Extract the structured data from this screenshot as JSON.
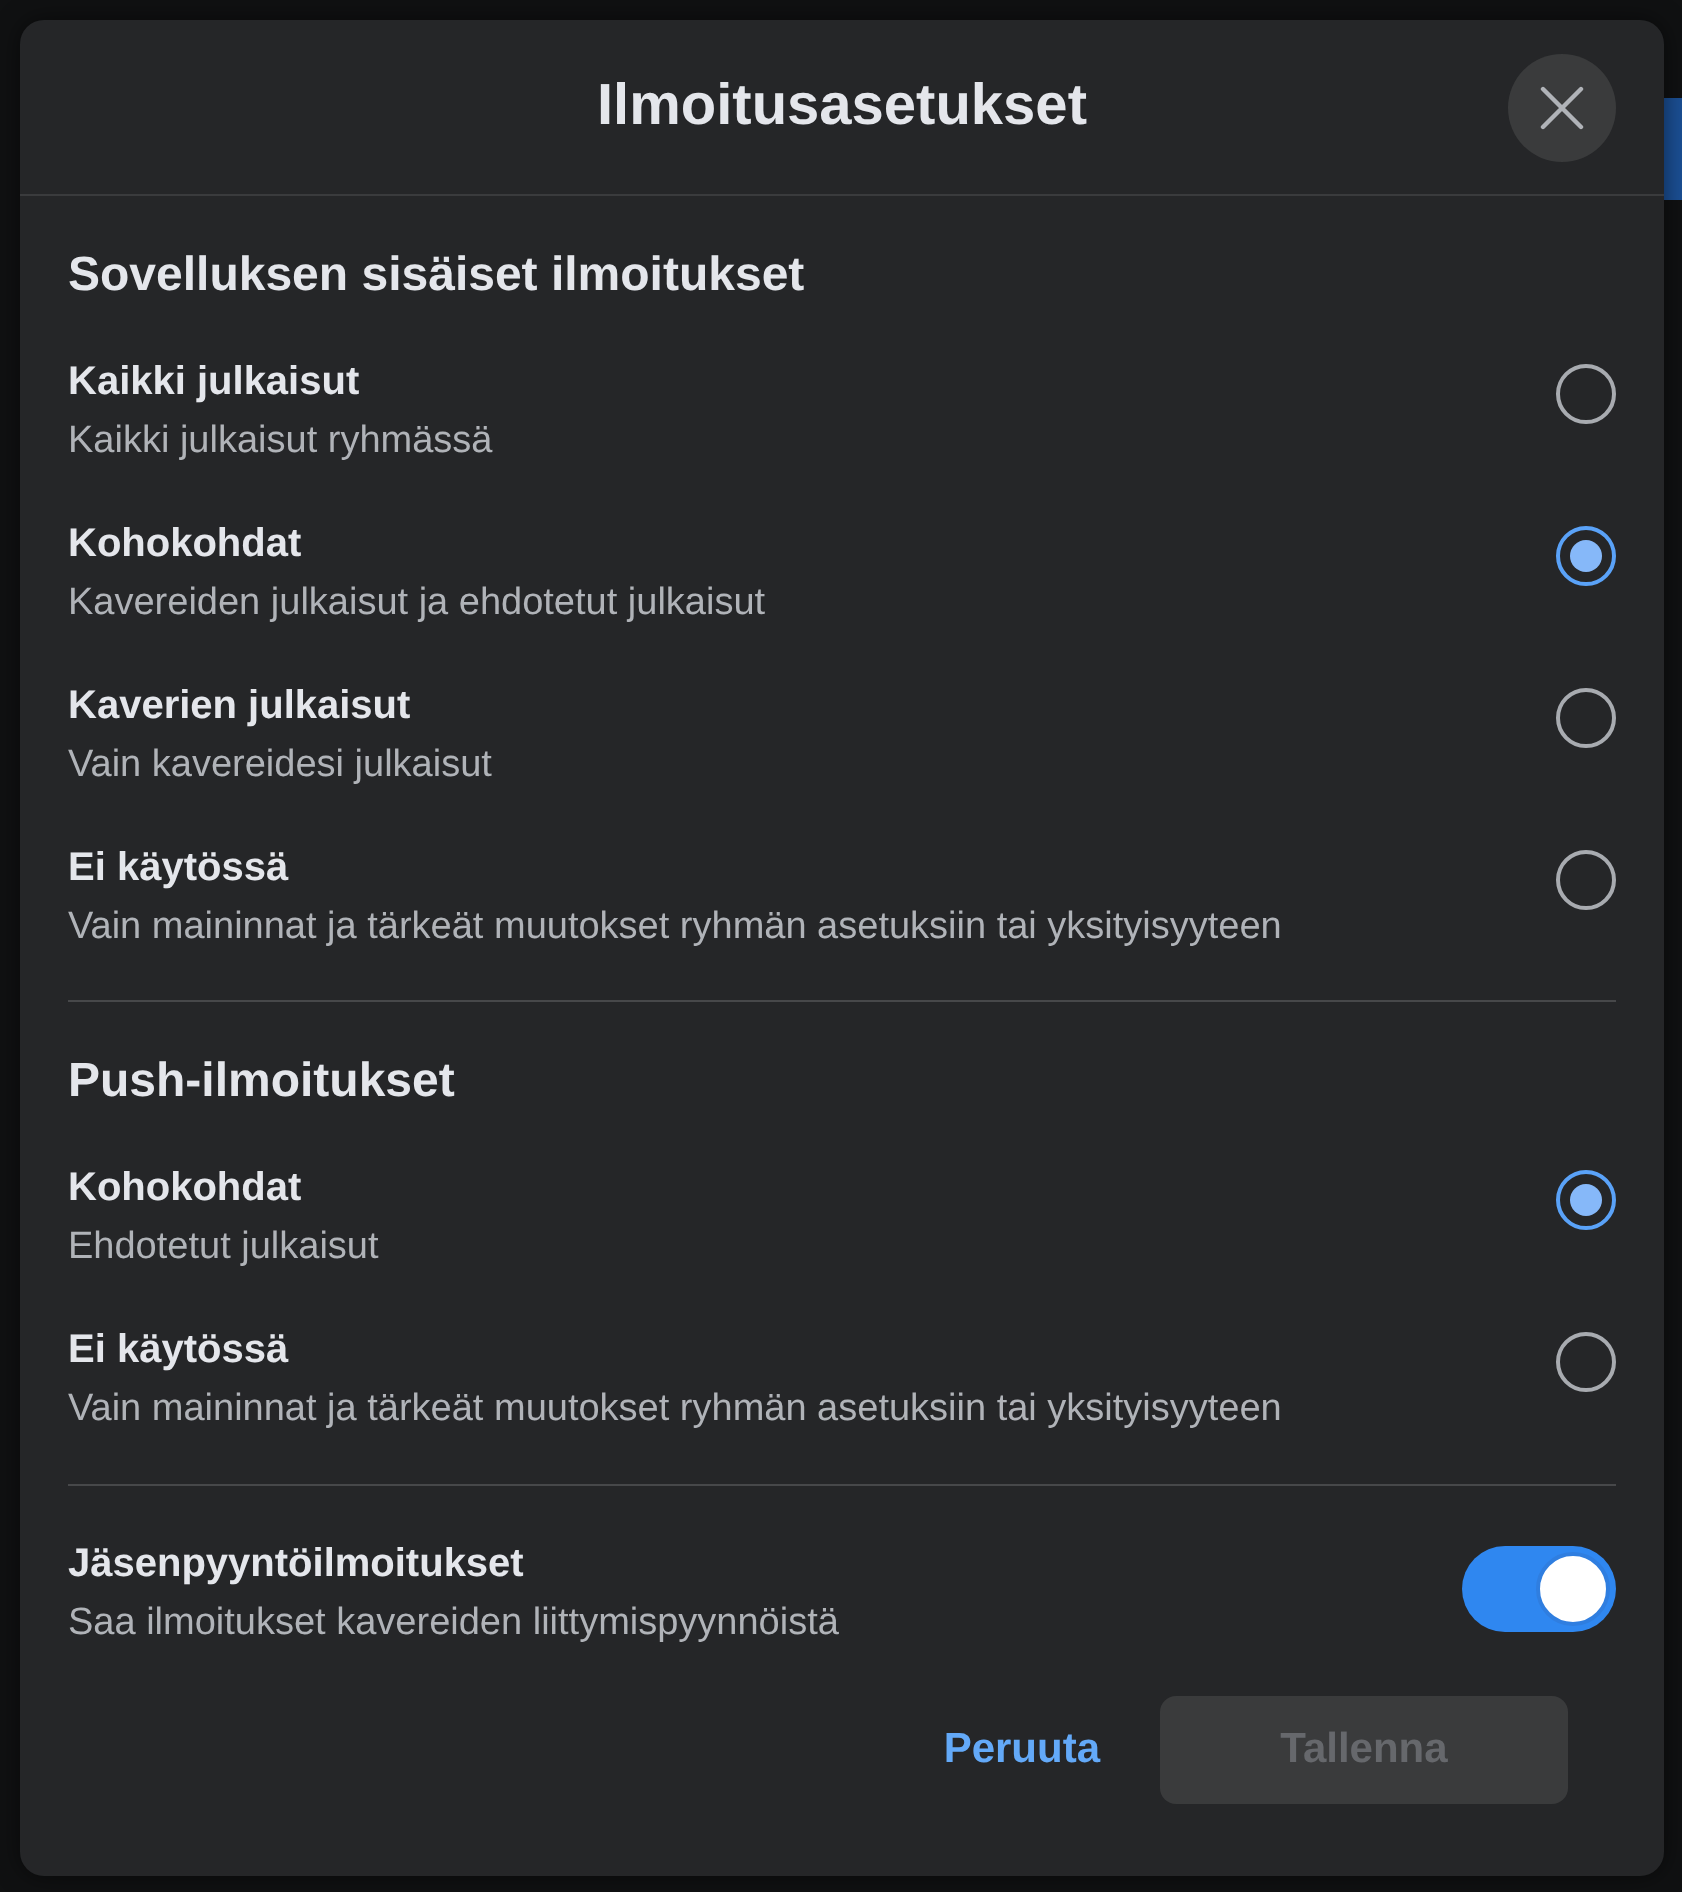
{
  "dialog": {
    "title": "Ilmoitusasetukset"
  },
  "sections": [
    {
      "heading": "Sovelluksen sisäiset ilmoitukset",
      "options": [
        {
          "title": "Kaikki julkaisut",
          "description": "Kaikki julkaisut ryhmässä",
          "selected": false
        },
        {
          "title": "Kohokohdat",
          "description": "Kavereiden julkaisut ja ehdotetut julkaisut",
          "selected": true
        },
        {
          "title": "Kaverien julkaisut",
          "description": "Vain kavereidesi julkaisut",
          "selected": false
        },
        {
          "title": "Ei käytössä",
          "description": "Vain maininnat ja tärkeät muutokset ryhmän asetuksiin tai yksityisyyteen",
          "selected": false
        }
      ]
    },
    {
      "heading": "Push-ilmoitukset",
      "options": [
        {
          "title": "Kohokohdat",
          "description": "Ehdotetut julkaisut",
          "selected": true
        },
        {
          "title": "Ei käytössä",
          "description": "Vain maininnat ja tärkeät muutokset ryhmän asetuksiin tai yksityisyyteen",
          "selected": false
        }
      ]
    }
  ],
  "toggle_setting": {
    "title": "Jäsenpyyntöilmoitukset",
    "description": "Saa ilmoitukset kavereiden liittymispyynnöistä",
    "on": true
  },
  "buttons": [
    {
      "label": "Peruuta",
      "kind": "link",
      "disabled": false
    },
    {
      "label": "Tallenna",
      "kind": "primary",
      "disabled": true
    }
  ]
}
